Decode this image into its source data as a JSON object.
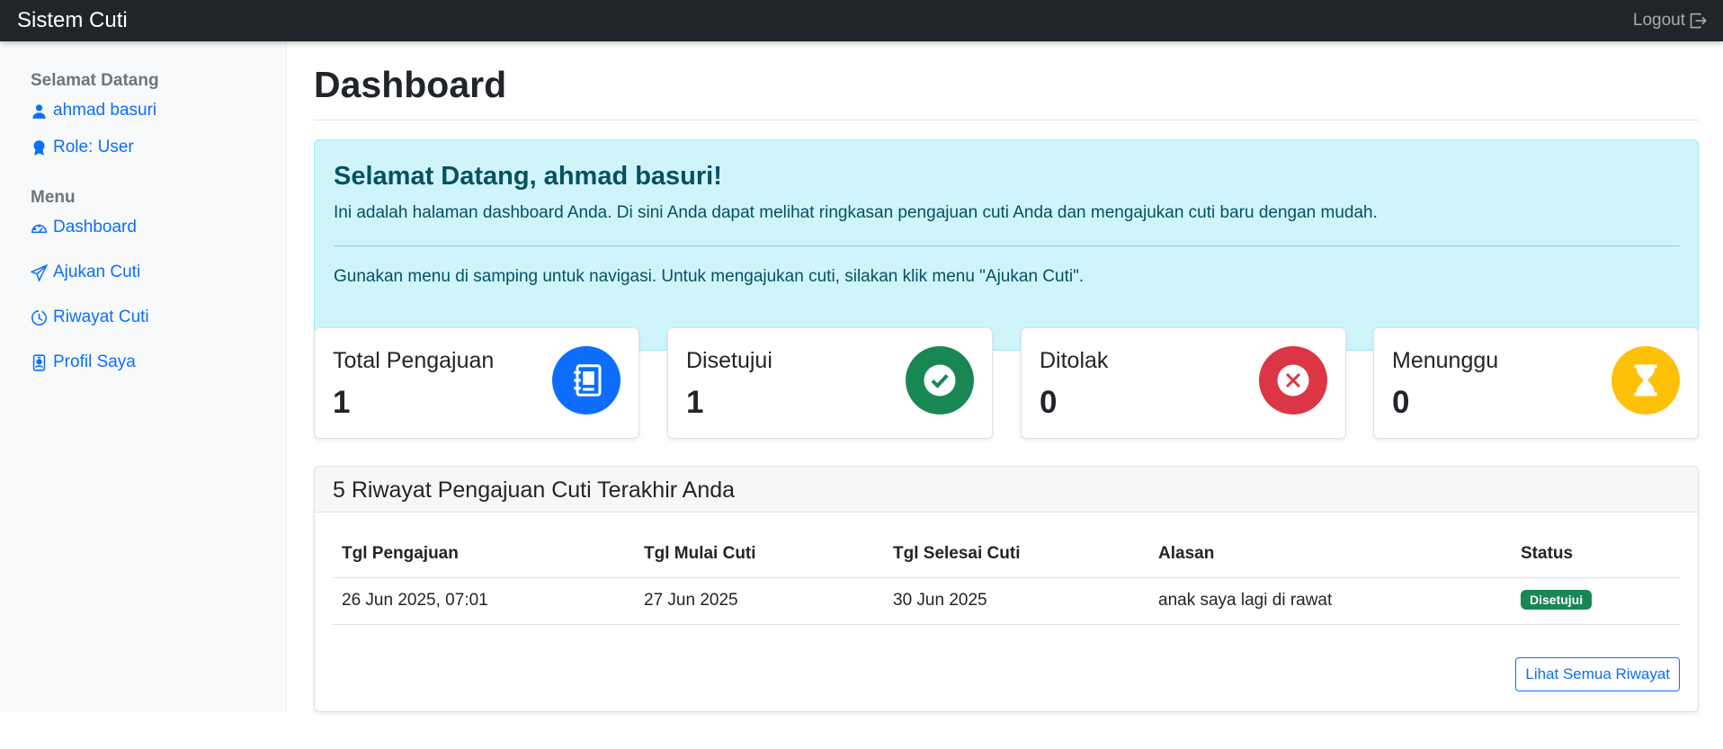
{
  "navbar": {
    "brand": "Sistem Cuti",
    "logout_label": "Logout",
    "logout_icon": "box-arrow-right-icon"
  },
  "sidebar": {
    "welcome_heading": "Selamat Datang",
    "user_name": "ahmad basuri",
    "role": "Role: User",
    "menu_heading": "Menu",
    "items": [
      {
        "label": "Dashboard",
        "icon": "speedometer-icon"
      },
      {
        "label": "Ajukan Cuti",
        "icon": "send-icon"
      },
      {
        "label": "Riwayat Cuti",
        "icon": "clock-history-icon"
      },
      {
        "label": "Profil Saya",
        "icon": "person-badge-icon"
      }
    ]
  },
  "main": {
    "title": "Dashboard",
    "alert": {
      "title": "Selamat Datang, ahmad basuri!",
      "text": "Ini adalah halaman dashboard Anda. Di sini Anda dapat melihat ringkasan pengajuan cuti Anda dan mengajukan cuti baru dengan mudah.",
      "text2": "Gunakan menu di samping untuk navigasi. Untuk mengajukan cuti, silakan klik menu \"Ajukan Cuti\"."
    },
    "stats": [
      {
        "label": "Total Pengajuan",
        "value": "1",
        "color": "#0d6efd",
        "icon": "journal-text-icon"
      },
      {
        "label": "Disetujui",
        "value": "1",
        "color": "#198754",
        "icon": "check-circle-icon"
      },
      {
        "label": "Ditolak",
        "value": "0",
        "color": "#dc3545",
        "icon": "x-circle-icon"
      },
      {
        "label": "Menunggu",
        "value": "0",
        "color": "#ffc107",
        "icon": "hourglass-icon"
      }
    ],
    "history": {
      "title": "5 Riwayat Pengajuan Cuti Terakhir Anda",
      "columns": [
        "Tgl Pengajuan",
        "Tgl Mulai Cuti",
        "Tgl Selesai Cuti",
        "Alasan",
        "Status"
      ],
      "rows": [
        {
          "tgl_pengajuan": "26 Jun 2025, 07:01",
          "tgl_mulai": "27 Jun 2025",
          "tgl_selesai": "30 Jun 2025",
          "alasan": "anak saya lagi di rawat",
          "status": "Disetujui",
          "status_color": "#198754"
        }
      ],
      "view_all_label": "Lihat Semua Riwayat"
    }
  }
}
